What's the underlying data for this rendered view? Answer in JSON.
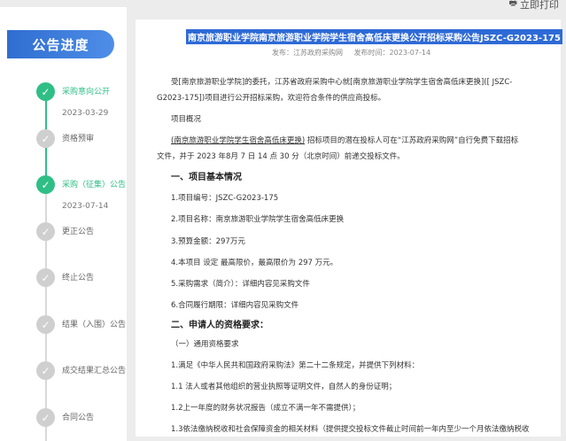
{
  "print_label": "立即打印",
  "sidebar": {
    "title": "公告进度",
    "steps": [
      {
        "label": "采购意向公开",
        "date": "2023-03-29",
        "status": "done"
      },
      {
        "label": "资格预审",
        "date": "",
        "status": "todo"
      },
      {
        "label": "采购（征集）公告",
        "date": "2023-07-14",
        "status": "done"
      },
      {
        "label": "更正公告",
        "date": "",
        "status": "todo"
      },
      {
        "label": "终止公告",
        "date": "",
        "status": "todo"
      },
      {
        "label": "结果（入围）公告",
        "date": "",
        "status": "todo"
      },
      {
        "label": "成交结果汇总公告",
        "date": "",
        "status": "todo"
      },
      {
        "label": "合同公告",
        "date": "",
        "status": "todo"
      }
    ]
  },
  "article": {
    "title": "南京旅游职业学院南京旅游职业学院学生宿舍高低床更换公开招标采购公告JSZC-G2023-175",
    "source": "发布：江苏政府采购网",
    "publish_time": "发布时间：2023-07-14",
    "intro_line1": "受[南京旅游职业学院]的委托，江苏省政府采购中心就[南京旅游职业学院学生宿舍高低床更换]([ JSZC-",
    "intro_line2": "G2023-175])项目进行公开招标采购，欢迎符合条件的供应商投标。",
    "overview_label": "项目概况",
    "overview_link": "(南京旅游职业学院学生宿舍高低床更换)",
    "overview_line1_rest": " 招标项目的潜在投标人可在“江苏政府采购网”自行免费下载招标",
    "overview_line2": "文件，并于    2023    年8月  7  日    14  点  30    分（北京时间）前递交投标文件。",
    "section1": "一、项目基本情况",
    "item1": "1.项目编号：JSZC-G2023-175",
    "item2": "2.项目名称：南京旅游职业学院学生宿舍高低床更换",
    "item3": "3.预算金额：297万元",
    "item4": "4.本项目    设定    最高限价，最高限价为     297     万元。",
    "item5": "5.采购需求（简介）：详细内容见采购文件",
    "item6": "6.合同履行期限：详细内容见采购文件",
    "section2": "二、申请人的资格要求：",
    "sub1": "（一）通用资格要求",
    "req1": "1.满足《中华人民共和国政府采购法》第二十二条规定，并提供下列材料：",
    "req1_1": "1.1 法人或者其他组织的营业执照等证明文件，自然人的身份证明；",
    "req1_2": "1.2上一年度的财务状况报告（成立不满一年不需提供）；",
    "req1_3": "1.3依法缴纳税收和社会保障资金的相关材料（提供提交投标文件截止时间前一年内至少一个月依法缴纳税收"
  }
}
